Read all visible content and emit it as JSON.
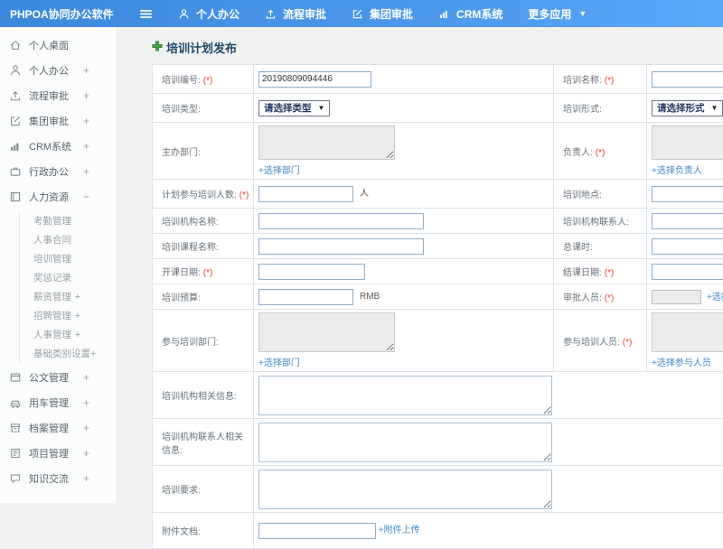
{
  "app": {
    "title": "PHPOA协同办公软件"
  },
  "topnav": {
    "items": [
      {
        "label": "个人办公",
        "icon": "user-icon"
      },
      {
        "label": "流程审批",
        "icon": "flow-icon"
      },
      {
        "label": "集团审批",
        "icon": "edit-icon"
      },
      {
        "label": "CRM系统",
        "icon": "chart-icon"
      },
      {
        "label": "更多应用",
        "icon": "caret-down-icon"
      }
    ]
  },
  "sidebar": {
    "items": [
      {
        "label": "个人桌面",
        "icon": "home-icon",
        "expand": ""
      },
      {
        "label": "个人办公",
        "icon": "user-icon",
        "expand": "+"
      },
      {
        "label": "流程审批",
        "icon": "flow-icon",
        "expand": "+"
      },
      {
        "label": "集团审批",
        "icon": "edit-icon",
        "expand": "+"
      },
      {
        "label": "CRM系统",
        "icon": "chart-icon",
        "expand": "+"
      },
      {
        "label": "行政办公",
        "icon": "briefcase-icon",
        "expand": "+"
      },
      {
        "label": "人力资源",
        "icon": "hr-icon",
        "expand": "−",
        "children": [
          {
            "label": "考勤管理",
            "expand": ""
          },
          {
            "label": "人事合同",
            "expand": ""
          },
          {
            "label": "培训管理",
            "expand": ""
          },
          {
            "label": "奖惩记录",
            "expand": ""
          },
          {
            "label": "薪资管理",
            "expand": "+"
          },
          {
            "label": "招聘管理",
            "expand": "+"
          },
          {
            "label": "人事管理",
            "expand": "+"
          },
          {
            "label": "基础类别设置",
            "expand": "+"
          }
        ]
      },
      {
        "label": "公文管理",
        "icon": "doc-icon",
        "expand": "+"
      },
      {
        "label": "用车管理",
        "icon": "car-icon",
        "expand": "+"
      },
      {
        "label": "档案管理",
        "icon": "archive-icon",
        "expand": "+"
      },
      {
        "label": "项目管理",
        "icon": "project-icon",
        "expand": "+"
      },
      {
        "label": "知识交流",
        "icon": "chat-icon",
        "expand": "+"
      }
    ]
  },
  "form": {
    "title": "培训计划发布",
    "required_mark": "(*)",
    "fields": {
      "number": {
        "label": "培训编号:",
        "value": "20190809094446"
      },
      "name": {
        "label": "培训名称:"
      },
      "type": {
        "label": "培训类型:",
        "select": "请选择类型"
      },
      "mode": {
        "label": "培训形式:",
        "select": "请选择形式"
      },
      "host_dept": {
        "label": "主办部门:",
        "link": "+选择部门"
      },
      "leader": {
        "label": "负责人:",
        "link": "+选择负责人"
      },
      "planned_count": {
        "label": "计划参与培训人数:",
        "suffix": "人"
      },
      "location": {
        "label": "培训地点:"
      },
      "org_name": {
        "label": "培训机构名称:"
      },
      "org_contact": {
        "label": "培训机构联系人:"
      },
      "course_name": {
        "label": "培训课程名称:"
      },
      "total_hours": {
        "label": "总课时:"
      },
      "start_date": {
        "label": "开课日期:"
      },
      "end_date": {
        "label": "结课日期:"
      },
      "budget": {
        "label": "培训预算:",
        "suffix": "RMB"
      },
      "approver": {
        "label": "审批人员:",
        "link": "+选择审批人员"
      },
      "join_depts": {
        "label": "参与培训部门:",
        "link": "+选择部门"
      },
      "join_people": {
        "label": "参与培训人员:",
        "link": "+选择参与人员"
      },
      "org_info": {
        "label": "培训机构相关信息:"
      },
      "org_contact_info": {
        "label": "培训机构联系人相关信息:"
      },
      "requirements": {
        "label": "培训要求:"
      },
      "attachment": {
        "label": "附件文档:",
        "link": "+附件上传"
      }
    }
  }
}
